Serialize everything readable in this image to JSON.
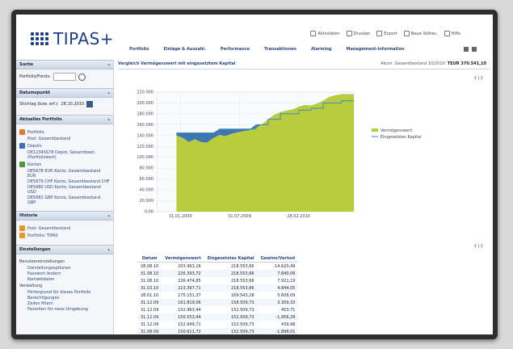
{
  "app": {
    "logo": "TIPAS+"
  },
  "toplinks": [
    "Aktivitäten",
    "Drucken",
    "Export",
    "Neue Vollrec.",
    "Hilfe"
  ],
  "nav": [
    "Portfolio",
    "Einlage & Auszahl.",
    "Performance",
    "Transaktionen",
    "Alarming",
    "Management-Information"
  ],
  "sidebar": {
    "suche": {
      "title": "Suche",
      "label": "Portfolio/Fonds:"
    },
    "datumspunkt": {
      "title": "Datumspunkt",
      "label": "Stichtag (bzw. erf.):",
      "value": "28.10.2010"
    },
    "aktuelles": {
      "title": "Aktuelles Portfolio",
      "portfolio_label": "Portfolio",
      "portfolio_sub": "Pool: Gesamtbestand",
      "depots_label": "Depots",
      "depots_sub": "DE12345678 Depot, Gesamtbest. (Portfoliowert)",
      "konten_label": "Konten",
      "konten_subs": [
        "DE5678 EUR Konto, Gesamtbestand EUR",
        "DE5679 CHF Konto, Gesamtbestand CHF",
        "DE5680 USD Konto, Gesamtbestand USD",
        "DE5681 GBP Konto, Gesamtbestand GBP"
      ]
    },
    "historie": {
      "title": "Historie",
      "items": [
        "Pool: Gesamtbestand",
        "Portfolio: TIPAS"
      ]
    },
    "einstellungen": {
      "title": "Einstellungen",
      "benutzer_label": "Benutzereinstellungen",
      "benutzer_items": [
        "Darstellungsoptionen",
        "Passwort ändern",
        "Kontaktdaten"
      ],
      "verwaltung_label": "Verwaltung",
      "verwaltung_items": [
        "Hintergrund für dieses Portfolio",
        "Berechtigungen",
        "Zeilen filtern",
        "Favoriten für neue Umgebung"
      ]
    }
  },
  "main": {
    "title": "Vergleich Vermögenswert mit eingesetztem Kapital",
    "info_label": "Akum. Gesamtbestand 10/2010:",
    "info_value": "TEUR 370.541,10",
    "chart_link": "1 | 1",
    "table_link": "1 | 1"
  },
  "chart_data": {
    "type": "area",
    "ylim": [
      0,
      220000
    ],
    "yticks": [
      "0,00",
      "20.000",
      "40.000",
      "60.000",
      "80.000",
      "100.000",
      "120.000",
      "140.000",
      "160.000",
      "180.000",
      "200.000",
      "220.000"
    ],
    "xticks": [
      "31.01.2009",
      "31.07.2009",
      "28.02.2010"
    ],
    "legend": [
      "Vermögenswert",
      "Eingesetztes Kapital"
    ],
    "colors": {
      "vermoegen": "#b9cd3c",
      "kapital": "#3f88c5",
      "underwater": "#1c5fa6"
    },
    "x": [
      0,
      1,
      2,
      3,
      4,
      5,
      6,
      7,
      8,
      9,
      10,
      11,
      12,
      13,
      14,
      15,
      16,
      17,
      18,
      19,
      20,
      21,
      22,
      23,
      24,
      25,
      26,
      27,
      28,
      29
    ],
    "series": [
      {
        "name": "Vermögenswert",
        "values": [
          140000,
          136000,
          128000,
          133000,
          128000,
          127000,
          135000,
          141000,
          139000,
          143000,
          146000,
          148000,
          150000,
          154000,
          161000,
          170000,
          178000,
          183000,
          186000,
          188000,
          193000,
          196000,
          195000,
          199000,
          204000,
          211000,
          214000,
          216000,
          216000,
          216000
        ]
      },
      {
        "name": "Eingesetztes Kapital",
        "values": [
          145000,
          145000,
          145000,
          145000,
          145000,
          145000,
          145000,
          152000,
          152000,
          152000,
          152000,
          152000,
          152000,
          160000,
          160000,
          170000,
          170000,
          180000,
          180000,
          180000,
          187000,
          187000,
          190000,
          190000,
          200000,
          200000,
          200000,
          204000,
          204000,
          204000
        ]
      }
    ]
  },
  "table": {
    "headers": [
      "Datum",
      "Vermögenswert",
      "Eingesetztes Kapital",
      "Gewinn/Verlust"
    ],
    "rows": [
      [
        "28.08.10",
        "203.963,16",
        "218.553,66",
        "-14.620,49"
      ],
      [
        "31.08.10",
        "226.393,72",
        "218.553,66",
        "7.840,06"
      ],
      [
        "31.08.10",
        "226.474,85",
        "218.553,66",
        "7.921,19"
      ],
      [
        "31.03.10",
        "223.397,71",
        "218.553,66",
        "4.844,05"
      ],
      [
        "28.01.10",
        "175.151,37",
        "169.543,28",
        "5.608,09"
      ],
      [
        "31.12.09",
        "161.819,06",
        "158.509,73",
        "3.309,33"
      ],
      [
        "31.12.09",
        "152.963,44",
        "152.509,73",
        "453,71"
      ],
      [
        "31.12.09",
        "150.553,44",
        "152.509,73",
        "-1.956,29"
      ],
      [
        "31.12.09",
        "152.949,71",
        "152.509,73",
        "439,98"
      ],
      [
        "31.08.09",
        "150.611,72",
        "152.509,73",
        "-1.898,01"
      ]
    ]
  }
}
